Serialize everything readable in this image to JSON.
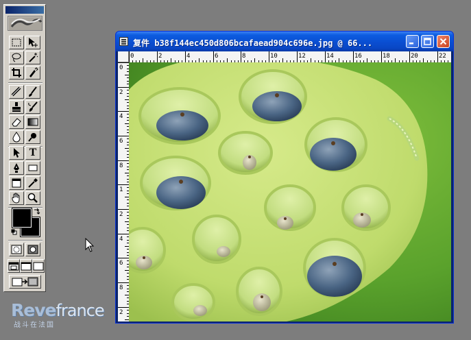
{
  "toolbox": {
    "tools": [
      {
        "name": "marquee-tool",
        "icon": "marquee-icon"
      },
      {
        "name": "move-tool",
        "icon": "move-icon"
      },
      {
        "name": "lasso-tool",
        "icon": "lasso-icon"
      },
      {
        "name": "magic-wand-tool",
        "icon": "magic-wand-icon"
      },
      {
        "name": "crop-tool",
        "icon": "crop-icon"
      },
      {
        "name": "eyedropper-slice-tool",
        "icon": "slice-icon"
      },
      {
        "name": "healing-brush-tool",
        "icon": "bandage-icon"
      },
      {
        "name": "brush-tool",
        "icon": "brush-icon"
      },
      {
        "name": "clone-stamp-tool",
        "icon": "stamp-icon"
      },
      {
        "name": "history-brush-tool",
        "icon": "history-brush-icon"
      },
      {
        "name": "eraser-tool",
        "icon": "eraser-icon"
      },
      {
        "name": "gradient-tool",
        "icon": "gradient-icon"
      },
      {
        "name": "blur-tool",
        "icon": "drop-icon"
      },
      {
        "name": "dodge-tool",
        "icon": "dodge-icon"
      },
      {
        "name": "path-select-tool",
        "icon": "arrow-icon"
      },
      {
        "name": "type-tool",
        "icon": "type-icon"
      },
      {
        "name": "pen-tool",
        "icon": "pen-icon"
      },
      {
        "name": "shape-tool",
        "icon": "rectangle-icon"
      },
      {
        "name": "notes-tool",
        "icon": "notes-icon"
      },
      {
        "name": "eyedropper-tool",
        "icon": "eyedropper-icon"
      },
      {
        "name": "hand-tool",
        "icon": "hand-icon"
      },
      {
        "name": "zoom-tool",
        "icon": "zoom-icon"
      }
    ],
    "colors": {
      "foreground": "#000000",
      "background": "#000000"
    },
    "type_tool_label": "T"
  },
  "document": {
    "title": "复件 b38f144ec450d806bcafaead904c696e.jpg @ 66...",
    "ruler_top_labels": [
      "0",
      "2",
      "4",
      "6",
      "8",
      "10",
      "12",
      "14",
      "16",
      "18",
      "20",
      "22"
    ],
    "ruler_left_labels": [
      "0",
      "2",
      "4",
      "6",
      "8",
      "1",
      "2",
      "4",
      "6",
      "8",
      "2"
    ]
  },
  "watermark": {
    "brand": "Reve",
    "brand_suffix": "france",
    "subtitle": "战斗在法国"
  },
  "colors": {
    "titlebar": "#0a4ed1",
    "desktop": "#7d7d7d",
    "toolbox": "#d4d0c8"
  }
}
